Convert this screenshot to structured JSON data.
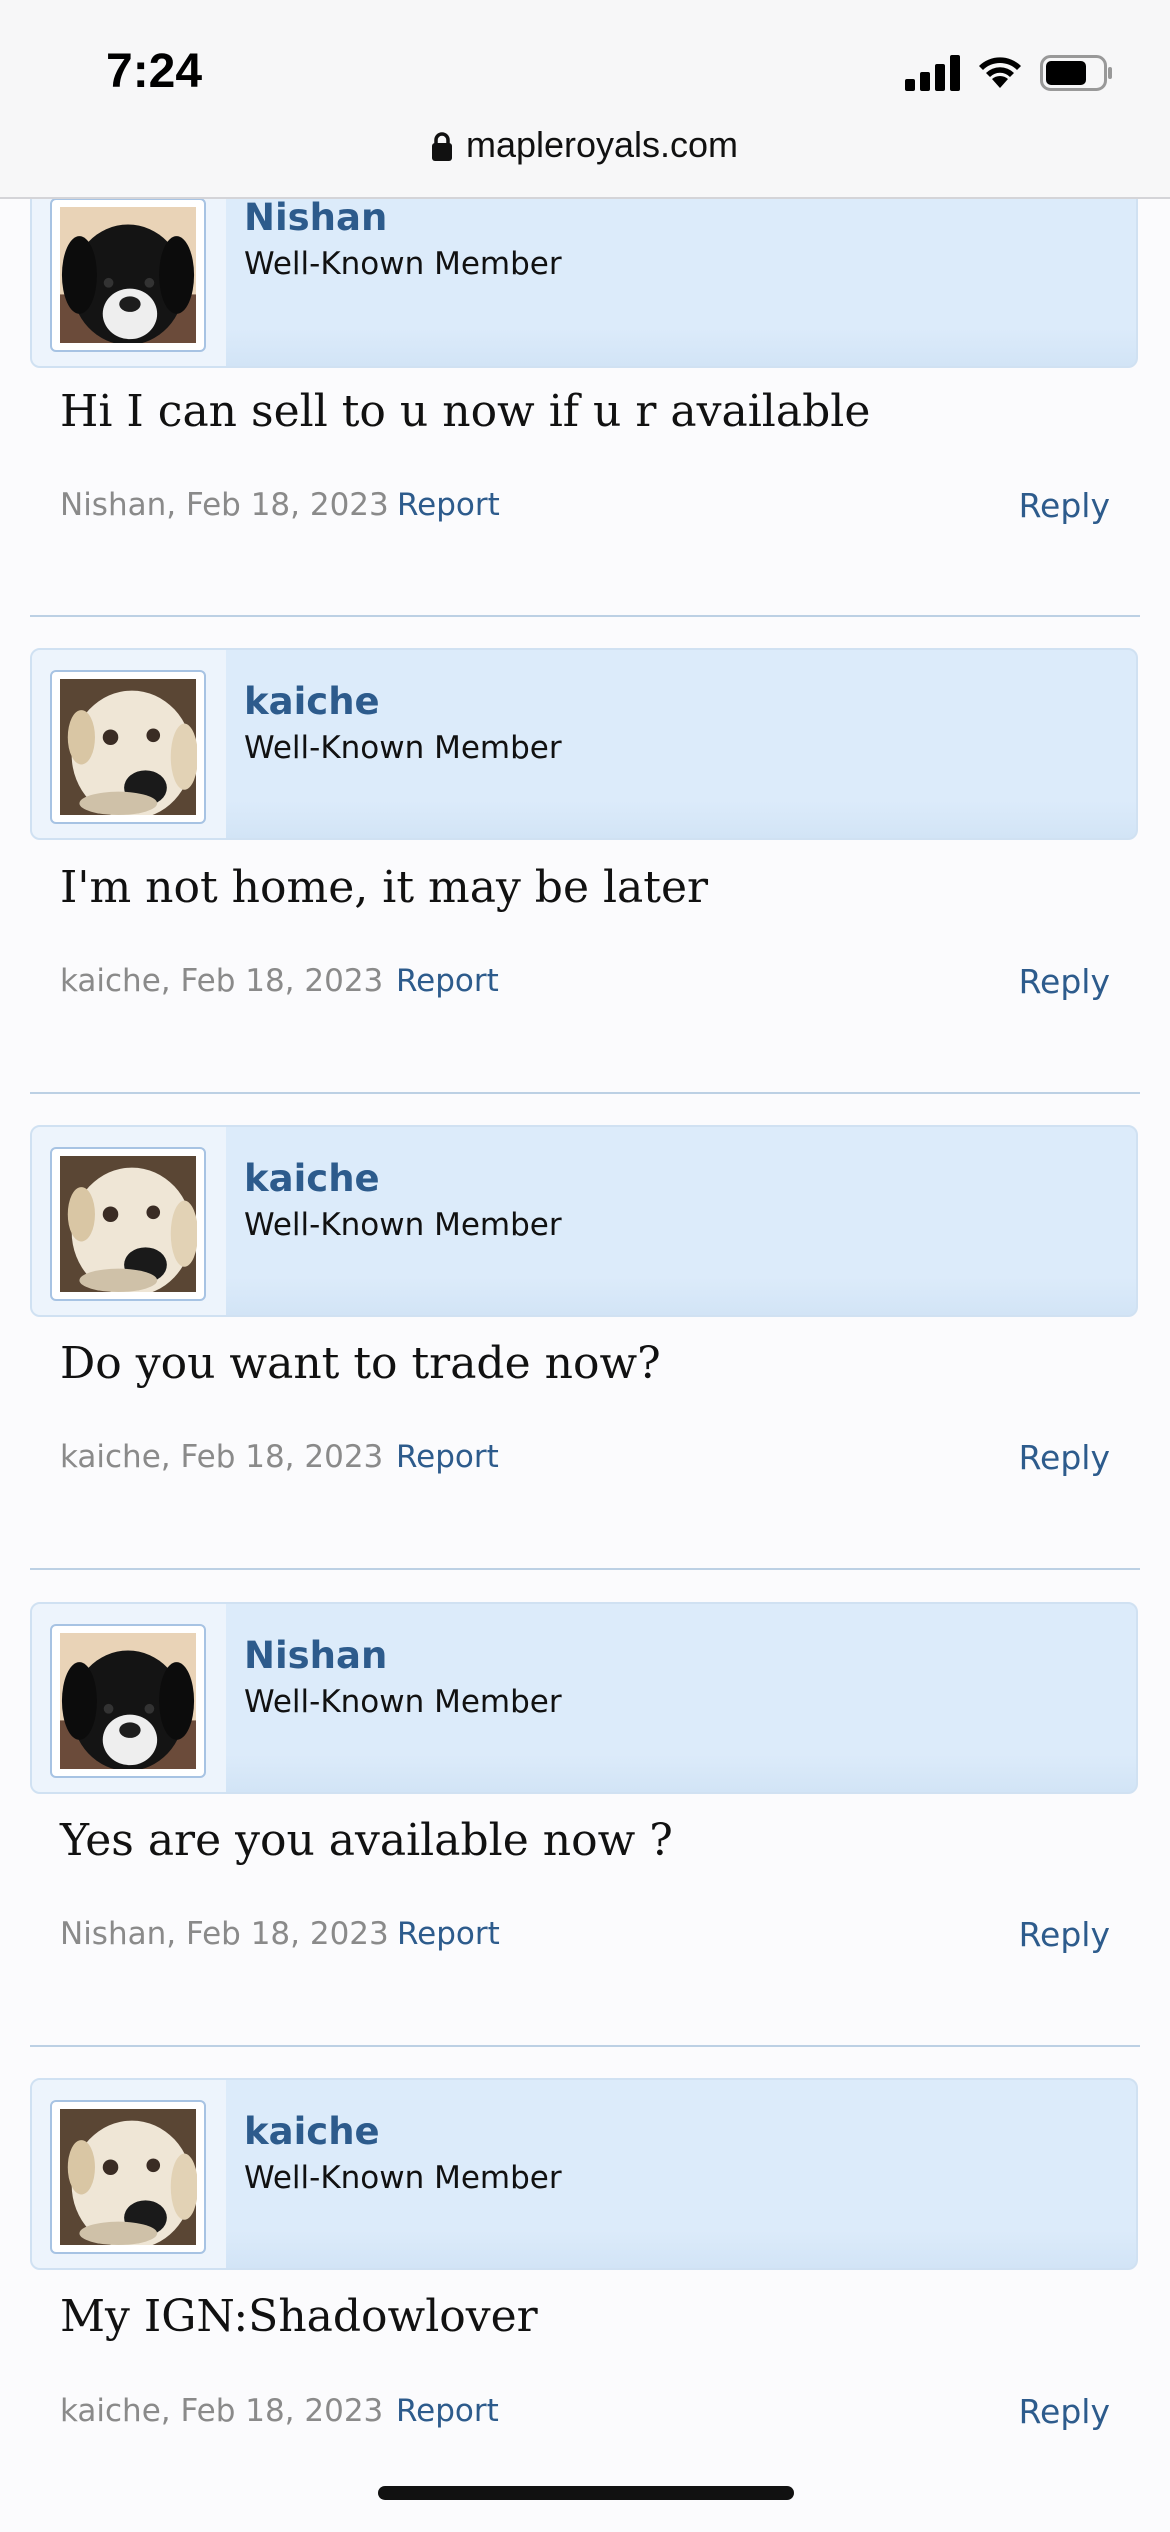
{
  "status": {
    "time": "7:24",
    "url": "mapleroyals.com"
  },
  "posts": [
    {
      "user": "Nishan",
      "title": "Well-Known Member",
      "message": "Hi I can sell to u now if u r available",
      "meta": "Nishan, Feb 18, 2023",
      "report": "Report",
      "reply": "Reply",
      "avatar": "black-dog-avatar"
    },
    {
      "user": "kaiche",
      "title": "Well-Known Member",
      "message": "I'm not home, it may be later",
      "meta": "kaiche, Feb 18, 2023",
      "report": "Report",
      "reply": "Reply",
      "avatar": "white-dog-avatar"
    },
    {
      "user": "kaiche",
      "title": "Well-Known Member",
      "message": "Do you want to trade now?",
      "meta": "kaiche, Feb 18, 2023",
      "report": "Report",
      "reply": "Reply",
      "avatar": "white-dog-avatar"
    },
    {
      "user": "Nishan",
      "title": "Well-Known Member",
      "message": "Yes are you available now ?",
      "meta": "Nishan, Feb 18, 2023",
      "report": "Report",
      "reply": "Reply",
      "avatar": "black-dog-avatar"
    },
    {
      "user": "kaiche",
      "title": "Well-Known Member",
      "message": "My IGN:Shadowlover",
      "meta": "kaiche, Feb 18, 2023",
      "report": "Report",
      "reply": "Reply",
      "avatar": "white-dog-avatar"
    }
  ]
}
